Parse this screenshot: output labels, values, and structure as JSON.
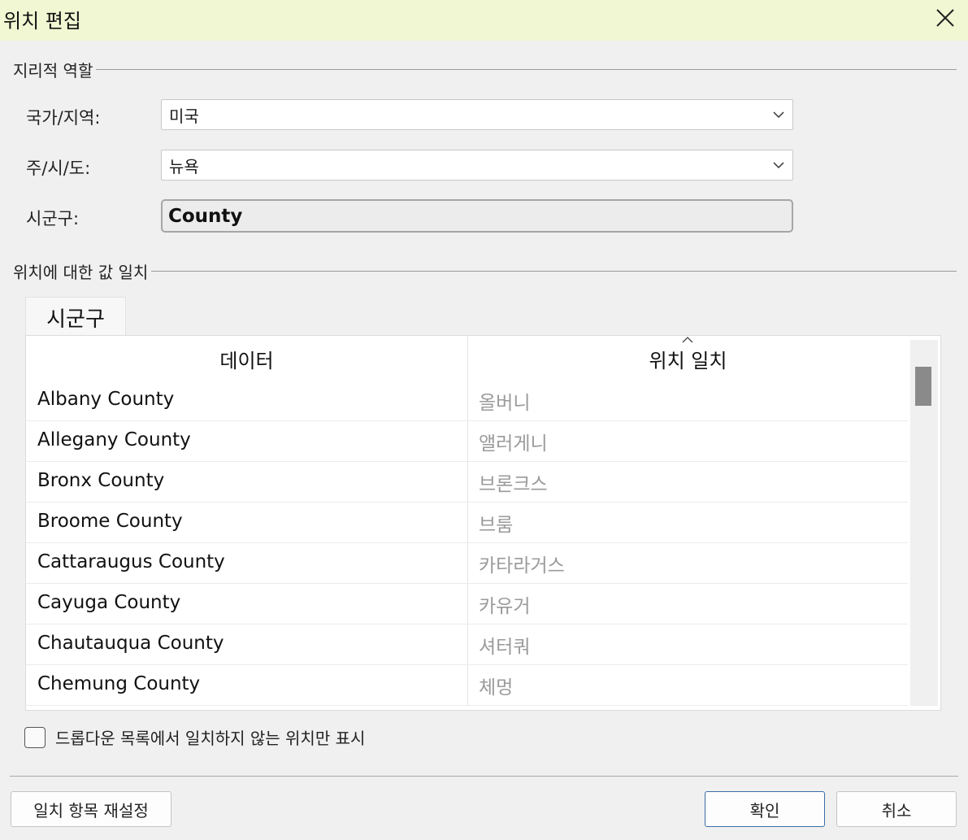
{
  "window": {
    "title": "위치 편집"
  },
  "geo_role": {
    "title": "지리적 역할",
    "country_label": "국가/지역:",
    "country_value": "미국",
    "state_label": "주/시/도:",
    "state_value": "뉴욕",
    "county_label": "시군구:",
    "county_value": "County"
  },
  "match": {
    "title": "위치에 대한 값 일치",
    "tab_label": "시군구",
    "columns": {
      "data": "데이터",
      "location": "위치 일치"
    },
    "rows": [
      {
        "data": "Albany County",
        "location": "올버니"
      },
      {
        "data": "Allegany County",
        "location": "앨러게니"
      },
      {
        "data": "Bronx County",
        "location": "브론크스"
      },
      {
        "data": "Broome County",
        "location": "브룸"
      },
      {
        "data": "Cattaraugus County",
        "location": "카타라거스"
      },
      {
        "data": "Cayuga County",
        "location": "카유거"
      },
      {
        "data": "Chautauqua County",
        "location": "셔터쿼"
      },
      {
        "data": "Chemung County",
        "location": "체멍"
      }
    ]
  },
  "filter": {
    "checkbox_label": "드롭다운 목록에서 일치하지 않는 위치만 표시",
    "checked": false
  },
  "buttons": {
    "reset": "일치 항목 재설정",
    "ok": "확인",
    "cancel": "취소"
  },
  "colors": {
    "titlebar_bg": "#f2f7d3",
    "dialog_bg": "#f0f0f0",
    "match_text": "#9a9a9a",
    "primary_border": "#3a6ea5"
  }
}
